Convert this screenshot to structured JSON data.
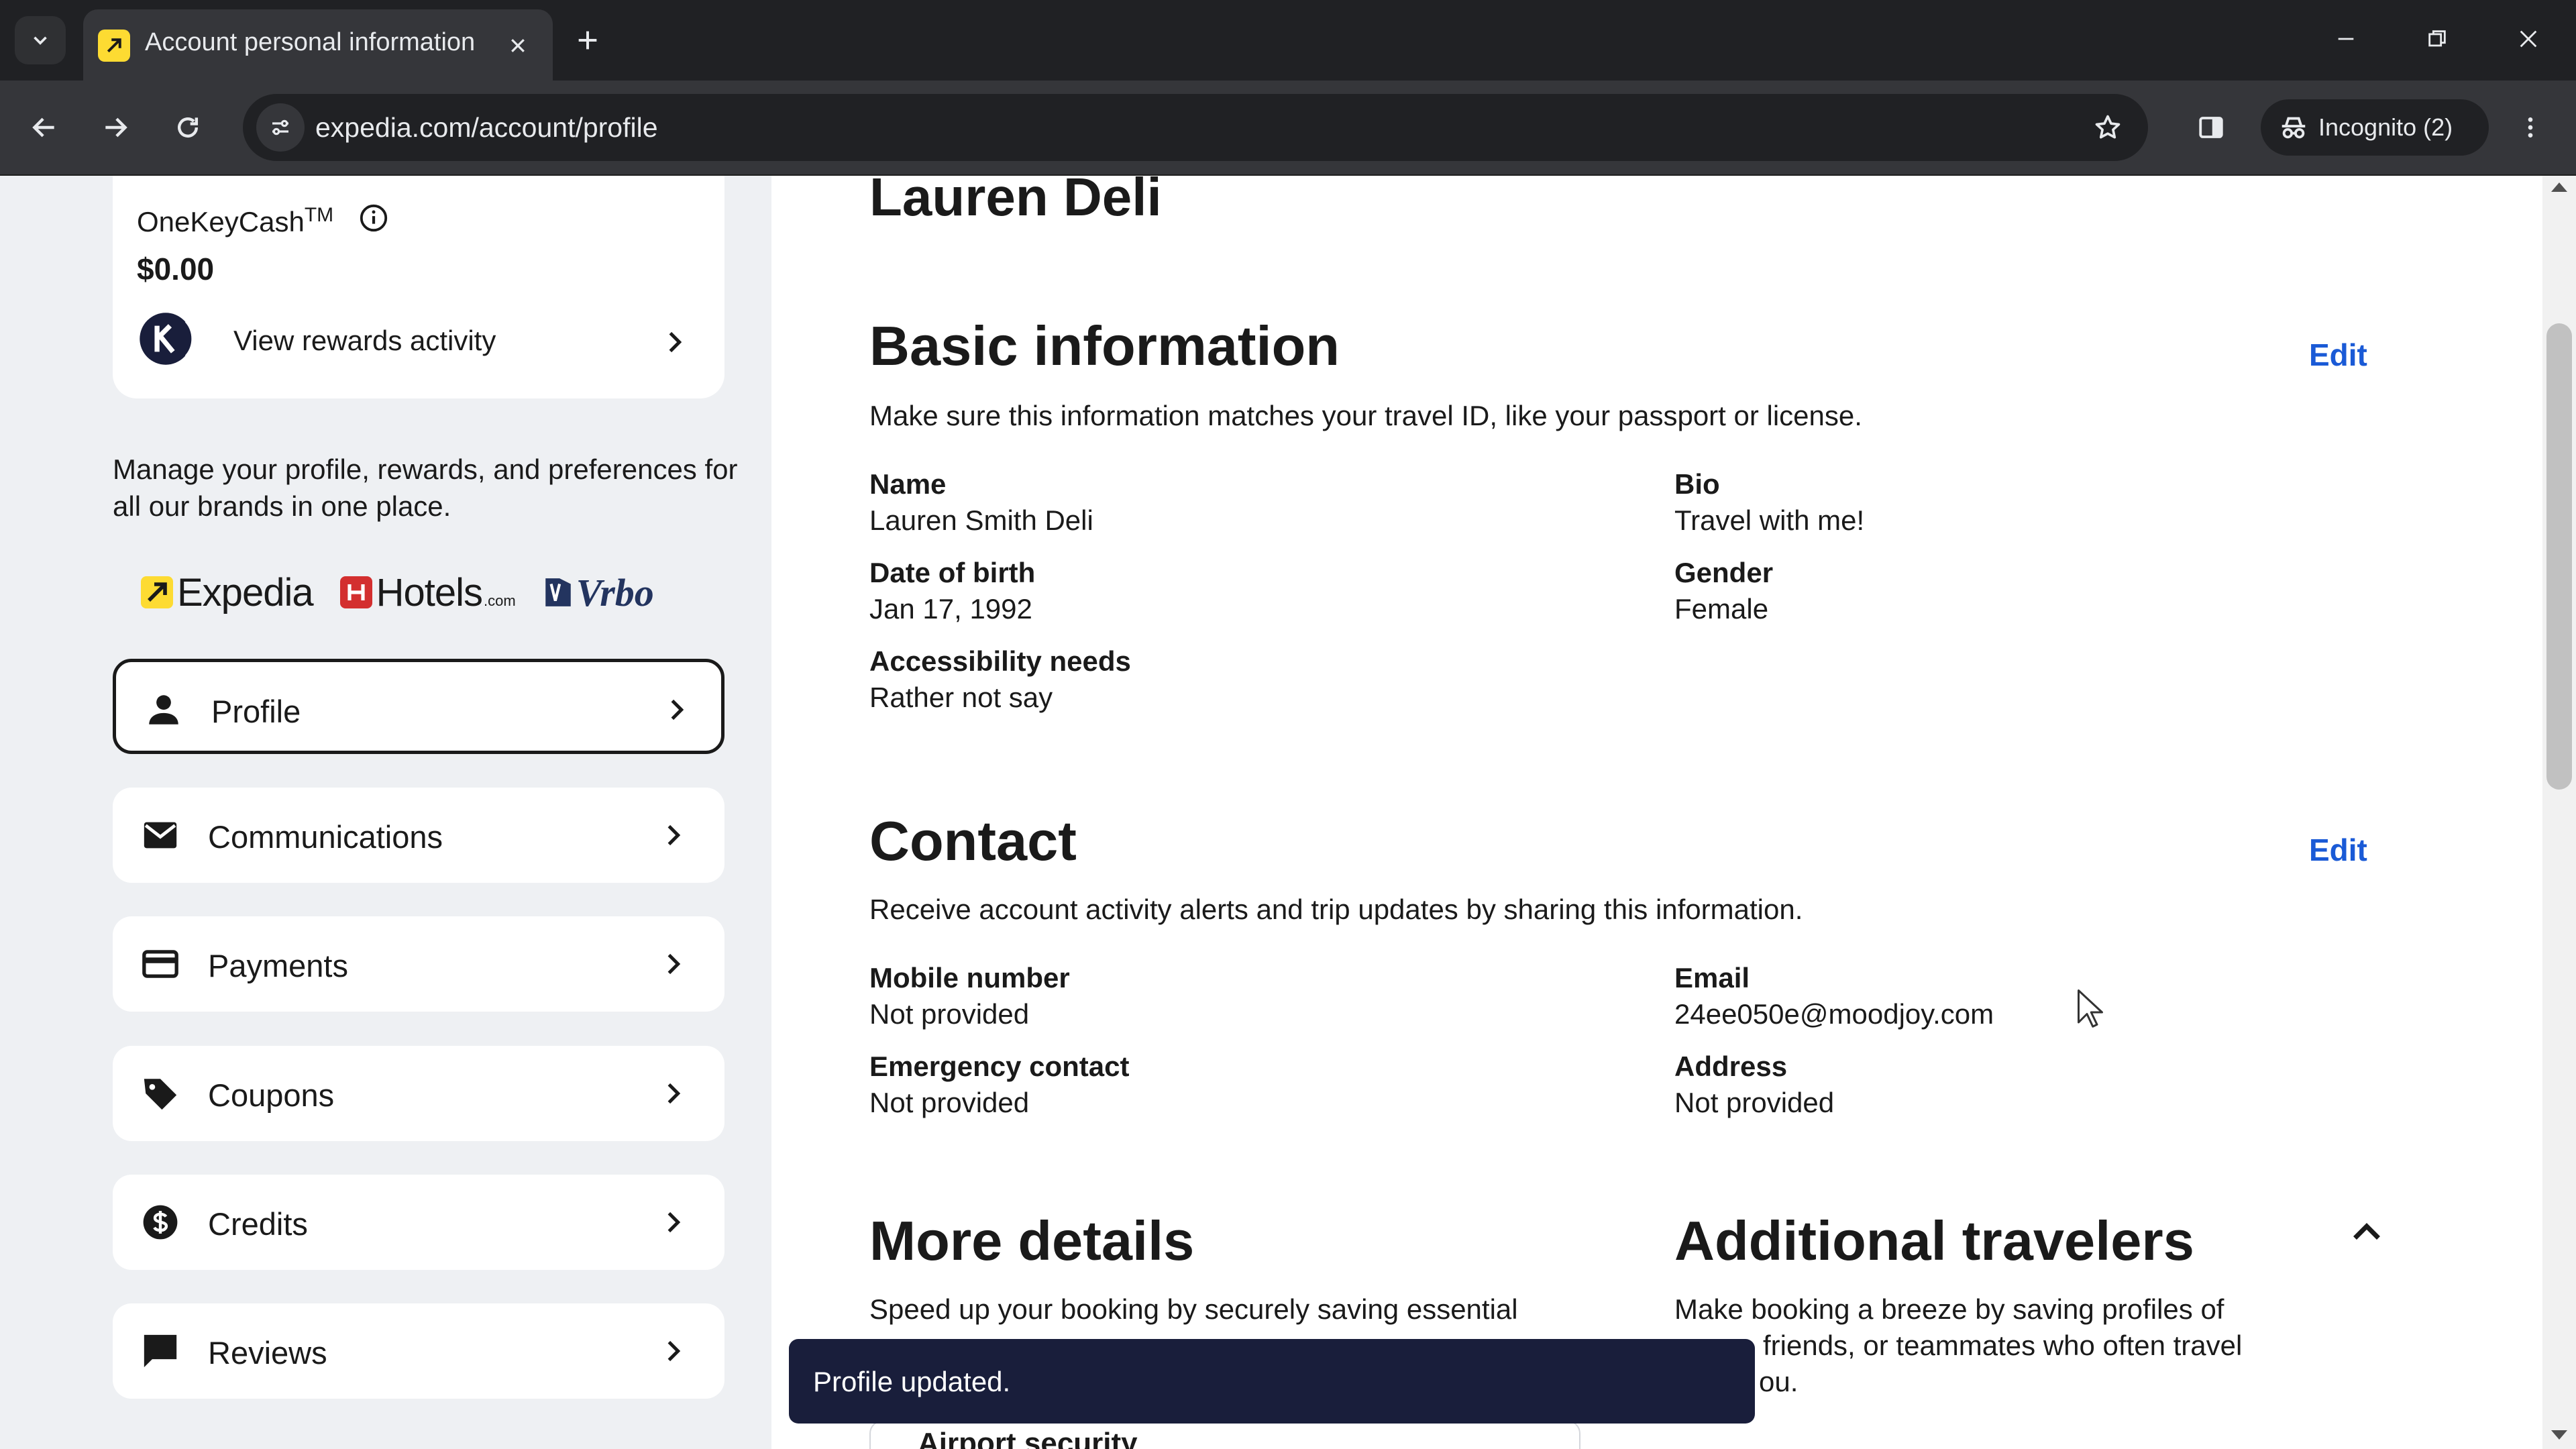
{
  "browser": {
    "tab_title": "Account personal information",
    "url": "expedia.com/account/profile",
    "incognito_label": "Incognito (2)"
  },
  "sidebar": {
    "rewards": {
      "label": "OneKeyCash",
      "trademark": "TM",
      "value": "$0.00",
      "link": "View rewards activity"
    },
    "manage_text": "Manage your profile, rewards, and preferences for all our brands in one place.",
    "brands": {
      "expedia": "Expedia",
      "hotels": "Hotels",
      "hotels_suffix": ".com",
      "vrbo": "Vrbo"
    },
    "nav": [
      {
        "label": "Profile",
        "icon": "person-icon",
        "active": true
      },
      {
        "label": "Communications",
        "icon": "mail-icon",
        "active": false
      },
      {
        "label": "Payments",
        "icon": "credit-card-icon",
        "active": false
      },
      {
        "label": "Coupons",
        "icon": "tag-icon",
        "active": false
      },
      {
        "label": "Credits",
        "icon": "dollar-circle-icon",
        "active": false
      },
      {
        "label": "Reviews",
        "icon": "comment-icon",
        "active": false
      }
    ]
  },
  "main": {
    "user_name": "Lauren Deli",
    "basic": {
      "title": "Basic information",
      "edit": "Edit",
      "description": "Make sure this information matches your travel ID, like your passport or license.",
      "name_label": "Name",
      "name_value": "Lauren Smith Deli",
      "bio_label": "Bio",
      "bio_value": "Travel with me!",
      "dob_label": "Date of birth",
      "dob_value": "Jan 17, 1992",
      "gender_label": "Gender",
      "gender_value": "Female",
      "access_label": "Accessibility needs",
      "access_value": "Rather not say"
    },
    "contact": {
      "title": "Contact",
      "edit": "Edit",
      "description": "Receive account activity alerts and trip updates by sharing this information.",
      "mobile_label": "Mobile number",
      "mobile_value": "Not provided",
      "email_label": "Email",
      "email_value": "24ee050e@moodjoy.com",
      "emergency_label": "Emergency contact",
      "emergency_value": "Not provided",
      "address_label": "Address",
      "address_value": "Not provided"
    },
    "more": {
      "title": "More details",
      "desc_line1": "Speed up your booking by securely saving essential",
      "airport_title": "Airport security"
    },
    "travelers": {
      "title": "Additional travelers",
      "desc_line1": "Make booking a breeze by saving profiles of",
      "desc_line2": "friends, or teammates who often travel",
      "desc_line3": "ou."
    }
  },
  "toast": {
    "message": "Profile updated."
  },
  "colors": {
    "link_blue": "#1a5ad6",
    "toast_bg": "#191e3b",
    "sidebar_bg": "#eef0f3",
    "expedia_yellow": "#fddb32",
    "hotels_red": "#d32f2f",
    "vrbo_navy": "#23345f"
  }
}
